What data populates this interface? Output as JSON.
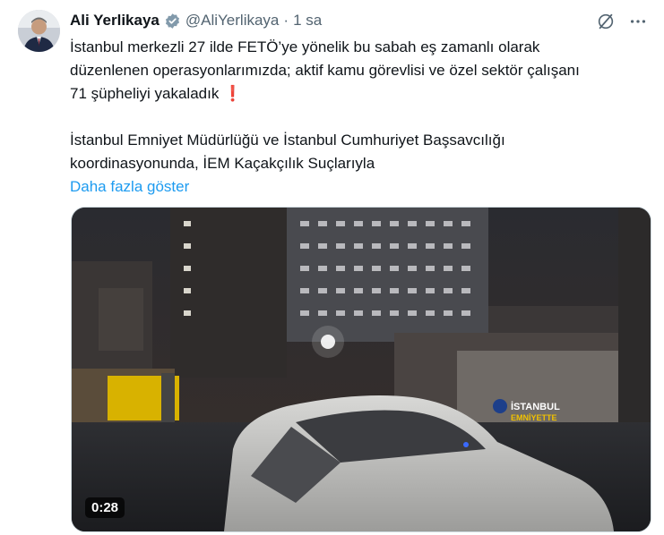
{
  "tweet": {
    "author_name": "Ali Yerlikaya",
    "author_handle": "@AliYerlikaya",
    "separator": "·",
    "time": "1 sa",
    "body_line1": "İstanbul merkezli 27 ilde FETÖ’ye yönelik bu sabah eş zamanlı olarak",
    "body_line2": "düzenlenen operasyonlarımızda; aktif kamu görevlisi ve özel sektör çalışanı",
    "body_line3": "71 şüpheliyi yakaladık",
    "body_emoji": "❗",
    "body2_line1": "İstanbul Emniyet Müdürlüğü ve İstanbul Cumhuriyet Başsavcılığı",
    "body2_line2": "koordinasyonunda, İEM Kaçakçılık Suçlarıyla",
    "show_more": "Daha fazla göster",
    "video_duration": "0:28",
    "sign_line1": "İSTANBUL",
    "sign_line2": "EMNİYETTE"
  },
  "icons": {
    "verified": "verified-badge-icon",
    "grok": "grok-icon",
    "more": "more-horizontal-icon"
  },
  "colors": {
    "accent": "#1d9bf0",
    "text": "#0f1419",
    "secondary": "#536471",
    "emoji_red": "#e0245e"
  }
}
